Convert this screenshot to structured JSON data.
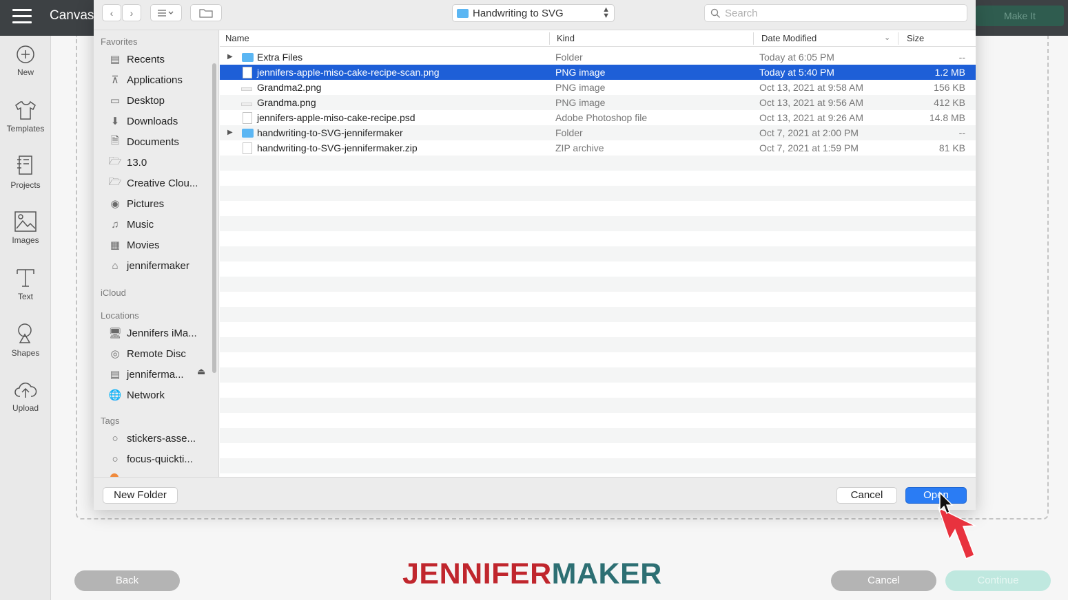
{
  "app": {
    "title": "Canvas",
    "make_it_label": "Make It",
    "nav": [
      {
        "label": "New",
        "icon": "plus-circle-icon"
      },
      {
        "label": "Templates",
        "icon": "tshirt-icon"
      },
      {
        "label": "Projects",
        "icon": "projects-icon"
      },
      {
        "label": "Images",
        "icon": "image-icon"
      },
      {
        "label": "Text",
        "icon": "text-icon"
      },
      {
        "label": "Shapes",
        "icon": "shapes-icon"
      },
      {
        "label": "Upload",
        "icon": "upload-cloud-icon"
      }
    ],
    "back_label": "Back",
    "cancel_label": "Cancel",
    "continue_label": "Continue",
    "brand_part1": "JENNIFER",
    "brand_part2": "MAKER",
    "colors": {
      "brand_red": "#c0262d",
      "brand_teal": "#2d6f73",
      "topbar": "#3d4144",
      "selection": "#1e5fd7",
      "continue": "#bfe8df"
    }
  },
  "dialog": {
    "current_folder": "Handwriting to SVG",
    "search_placeholder": "Search",
    "sidebar": {
      "favorites_header": "Favorites",
      "favorites": [
        {
          "label": "Recents",
          "icon": "recents-icon"
        },
        {
          "label": "Applications",
          "icon": "applications-icon"
        },
        {
          "label": "Desktop",
          "icon": "desktop-icon"
        },
        {
          "label": "Downloads",
          "icon": "downloads-icon"
        },
        {
          "label": "Documents",
          "icon": "documents-icon"
        },
        {
          "label": "13.0",
          "icon": "folder-icon"
        },
        {
          "label": "Creative Clou...",
          "icon": "folder-icon"
        },
        {
          "label": "Pictures",
          "icon": "camera-icon"
        },
        {
          "label": "Music",
          "icon": "music-icon"
        },
        {
          "label": "Movies",
          "icon": "film-icon"
        },
        {
          "label": "jennifermaker",
          "icon": "home-icon"
        }
      ],
      "icloud_header": "iCloud",
      "locations_header": "Locations",
      "locations": [
        {
          "label": "Jennifers iMa...",
          "icon": "computer-icon"
        },
        {
          "label": "Remote Disc",
          "icon": "disc-icon"
        },
        {
          "label": "jenniferma...",
          "icon": "drive-icon"
        },
        {
          "label": "Network",
          "icon": "globe-icon"
        }
      ],
      "tags_header": "Tags",
      "tags": [
        {
          "label": "stickers-asse..."
        },
        {
          "label": "focus-quickti..."
        }
      ]
    },
    "columns": {
      "name": "Name",
      "kind": "Kind",
      "date": "Date Modified",
      "size": "Size"
    },
    "files": [
      {
        "name": "Extra Files",
        "kind": "Folder",
        "date": "Today at 6:05 PM",
        "size": "--",
        "type": "folder",
        "selected": false
      },
      {
        "name": "jennifers-apple-miso-cake-recipe-scan.png",
        "kind": "PNG image",
        "date": "Today at 5:40 PM",
        "size": "1.2 MB",
        "type": "doc",
        "selected": true
      },
      {
        "name": "Grandma2.png",
        "kind": "PNG image",
        "date": "Oct 13, 2021 at 9:58 AM",
        "size": "156 KB",
        "type": "flat",
        "selected": false
      },
      {
        "name": "Grandma.png",
        "kind": "PNG image",
        "date": "Oct 13, 2021 at 9:56 AM",
        "size": "412 KB",
        "type": "flat",
        "selected": false
      },
      {
        "name": "jennifers-apple-miso-cake-recipe.psd",
        "kind": "Adobe Photoshop file",
        "date": "Oct 13, 2021 at 9:26 AM",
        "size": "14.8 MB",
        "type": "doc",
        "selected": false
      },
      {
        "name": "handwriting-to-SVG-jennifermaker",
        "kind": "Folder",
        "date": "Oct 7, 2021 at 2:00 PM",
        "size": "--",
        "type": "folder",
        "selected": false
      },
      {
        "name": "handwriting-to-SVG-jennifermaker.zip",
        "kind": "ZIP archive",
        "date": "Oct 7, 2021 at 1:59 PM",
        "size": "81 KB",
        "type": "doc",
        "selected": false
      }
    ],
    "new_folder_label": "New Folder",
    "cancel_label": "Cancel",
    "open_label": "Open"
  }
}
